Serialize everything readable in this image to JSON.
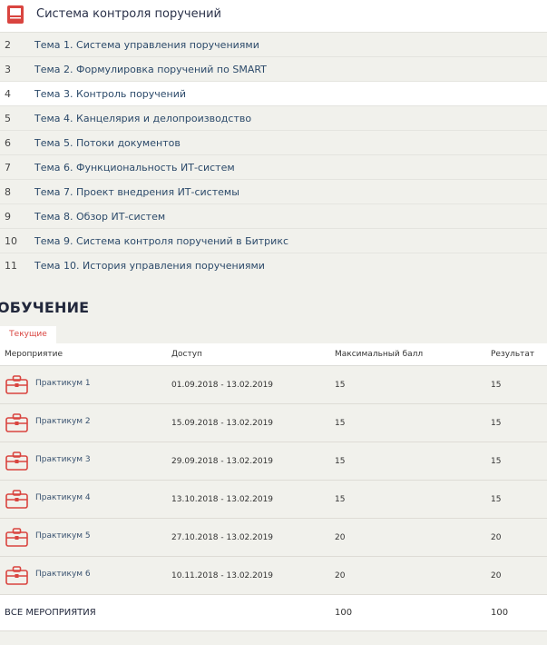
{
  "course": {
    "title": "Система контроля поручений"
  },
  "topics": [
    {
      "num": "2",
      "label": "Тема 1. Система управления поручениями"
    },
    {
      "num": "3",
      "label": "Тема 2. Формулировка поручений по SMART"
    },
    {
      "num": "4",
      "label": "Тема 3. Контроль поручений"
    },
    {
      "num": "5",
      "label": "Тема 4. Канцелярия и делопроизводство"
    },
    {
      "num": "6",
      "label": "Тема 5. Потоки документов"
    },
    {
      "num": "7",
      "label": "Тема 6. Функциональность ИТ-систем"
    },
    {
      "num": "8",
      "label": "Тема 7. Проект внедрения ИТ-системы"
    },
    {
      "num": "9",
      "label": "Тема 8. Обзор ИТ-систем"
    },
    {
      "num": "10",
      "label": "Тема 9. Система контроля поручений в Битрикс"
    },
    {
      "num": "11",
      "label": "Тема 10. История управления поручениями"
    }
  ],
  "section_title": "ОБУЧЕНИЕ",
  "tab_current": "Текущие",
  "table": {
    "headers": {
      "event": "Мероприятие",
      "access": "Доступ",
      "max": "Максимальный балл",
      "result": "Результат"
    },
    "rows": [
      {
        "name": "Практикум 1",
        "access": "01.09.2018 - 13.02.2019",
        "max": "15",
        "result": "15"
      },
      {
        "name": "Практикум 2",
        "access": "15.09.2018 - 13.02.2019",
        "max": "15",
        "result": "15"
      },
      {
        "name": "Практикум 3",
        "access": "29.09.2018 - 13.02.2019",
        "max": "15",
        "result": "15"
      },
      {
        "name": "Практикум 4",
        "access": "13.10.2018 - 13.02.2019",
        "max": "15",
        "result": "15"
      },
      {
        "name": "Практикум 5",
        "access": "27.10.2018 - 13.02.2019",
        "max": "20",
        "result": "20"
      },
      {
        "name": "Практикум 6",
        "access": "10.11.2018 - 13.02.2019",
        "max": "20",
        "result": "20"
      }
    ],
    "total": {
      "label": "ВСЕ МЕРОПРИЯТИЯ",
      "max": "100",
      "result": "100"
    }
  },
  "colors": {
    "accent": "#d9443f",
    "title": "#22283c",
    "link": "#2c4a6a",
    "background": "#f1f1ec"
  },
  "icons": {
    "course": "book-icon",
    "event": "briefcase-icon"
  }
}
